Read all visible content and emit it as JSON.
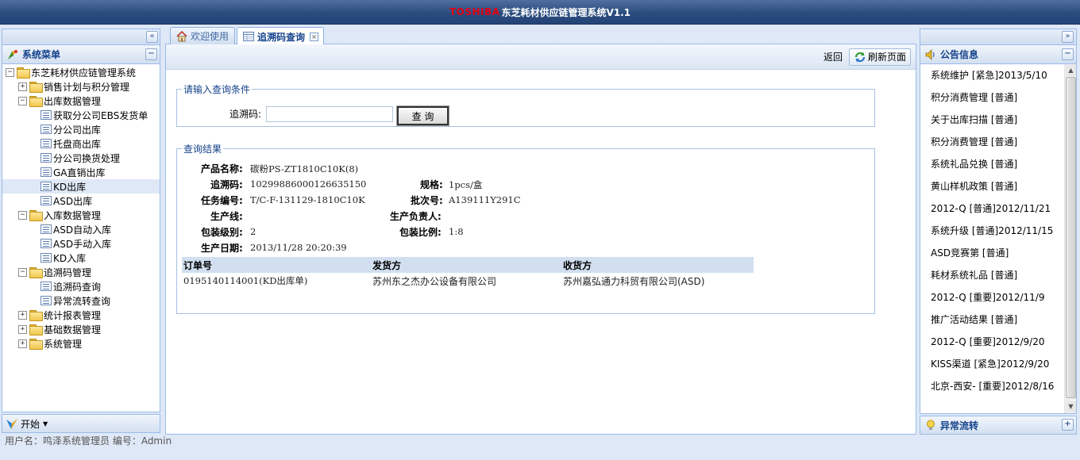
{
  "app": {
    "brand": "TOSHIBA",
    "title": "东芝耗材供应链管理系统V1.1"
  },
  "menu": {
    "title": "系统菜单",
    "tree": [
      {
        "label": "东芝耗材供应链管理系统",
        "level": 0,
        "type": "folder",
        "exp": "−"
      },
      {
        "label": "销售计划与积分管理",
        "level": 1,
        "type": "folder",
        "exp": "+"
      },
      {
        "label": "出库数据管理",
        "level": 1,
        "type": "folder",
        "exp": "−"
      },
      {
        "label": "获取分公司EBS发货单",
        "level": 2,
        "type": "leaf"
      },
      {
        "label": "分公司出库",
        "level": 2,
        "type": "leaf"
      },
      {
        "label": "托盘商出库",
        "level": 2,
        "type": "leaf"
      },
      {
        "label": "分公司换货处理",
        "level": 2,
        "type": "leaf"
      },
      {
        "label": "GA直销出库",
        "level": 2,
        "type": "leaf"
      },
      {
        "label": "KD出库",
        "level": 2,
        "type": "leaf",
        "selected": true
      },
      {
        "label": "ASD出库",
        "level": 2,
        "type": "leaf"
      },
      {
        "label": "入库数据管理",
        "level": 1,
        "type": "folder",
        "exp": "−"
      },
      {
        "label": "ASD自动入库",
        "level": 2,
        "type": "leaf"
      },
      {
        "label": "ASD手动入库",
        "level": 2,
        "type": "leaf"
      },
      {
        "label": "KD入库",
        "level": 2,
        "type": "leaf"
      },
      {
        "label": "追溯码管理",
        "level": 1,
        "type": "folder",
        "exp": "−"
      },
      {
        "label": "追溯码查询",
        "level": 2,
        "type": "leaf"
      },
      {
        "label": "异常流转查询",
        "level": 2,
        "type": "leaf"
      },
      {
        "label": "统计报表管理",
        "level": 1,
        "type": "folder",
        "exp": "+"
      },
      {
        "label": "基础数据管理",
        "level": 1,
        "type": "folder",
        "exp": "+"
      },
      {
        "label": "系统管理",
        "level": 1,
        "type": "folder",
        "exp": "+"
      }
    ]
  },
  "tabs": [
    {
      "label": "欢迎使用"
    },
    {
      "label": "追溯码查询"
    }
  ],
  "toolbar": {
    "back": "返回",
    "refresh": "刷新页面"
  },
  "query": {
    "legend": "请输入查询条件",
    "code_label": "追溯码:",
    "code_value": "",
    "button": "查 询"
  },
  "result": {
    "legend": "查询结果",
    "product_label": "产品名称:",
    "product": "碳粉PS-ZT1810C10K(8)",
    "trace_label": "追溯码:",
    "trace": "10299886000126635150",
    "spec_label": "规格:",
    "spec": "1pcs/盒",
    "task_label": "任务编号:",
    "task": "T/C-F-131129-1810C10K",
    "batch_label": "批次号:",
    "batch": "A139111Y291C",
    "line_label": "生产线:",
    "line": "",
    "owner_label": "生产负责人:",
    "owner": "",
    "pack_level_label": "包装级别:",
    "pack_level": "2",
    "pack_ratio_label": "包装比例:",
    "pack_ratio": "1:8",
    "date_label": "生产日期:",
    "date": "2013/11/28 20:20:39",
    "table": {
      "headers": [
        "订单号",
        "发货方",
        "收货方"
      ],
      "rows": [
        [
          "0195140114001(KD出库单)",
          "苏州东之杰办公设备有限公司",
          "苏州嘉弘通力科贸有限公司(ASD)"
        ]
      ]
    }
  },
  "notice": {
    "title": "公告信息",
    "items": [
      "系统维护 [紧急]2013/5/10",
      "积分消费管理 [普通]",
      "关于出库扫描 [普通]",
      "积分消费管理 [普通]",
      "系统礼品兑换 [普通]",
      "黄山样机政策 [普通]",
      "2012-Q [普通]2012/11/21",
      "系统升级 [普通]2012/11/15",
      "ASD竞赛第 [普通]",
      "耗材系统礼品 [普通]",
      "2012-Q [重要]2012/11/9",
      "推广活动结果 [普通]",
      "2012-Q [重要]2012/9/20",
      "KISS渠道 [紧急]2012/9/20",
      "北京-西安- [重要]2012/8/16"
    ]
  },
  "abnormal": {
    "title": "异常流转"
  },
  "start": {
    "label": "开始"
  },
  "status": {
    "text": "用户名：鸣泽系统管理员 编号：Admin"
  }
}
